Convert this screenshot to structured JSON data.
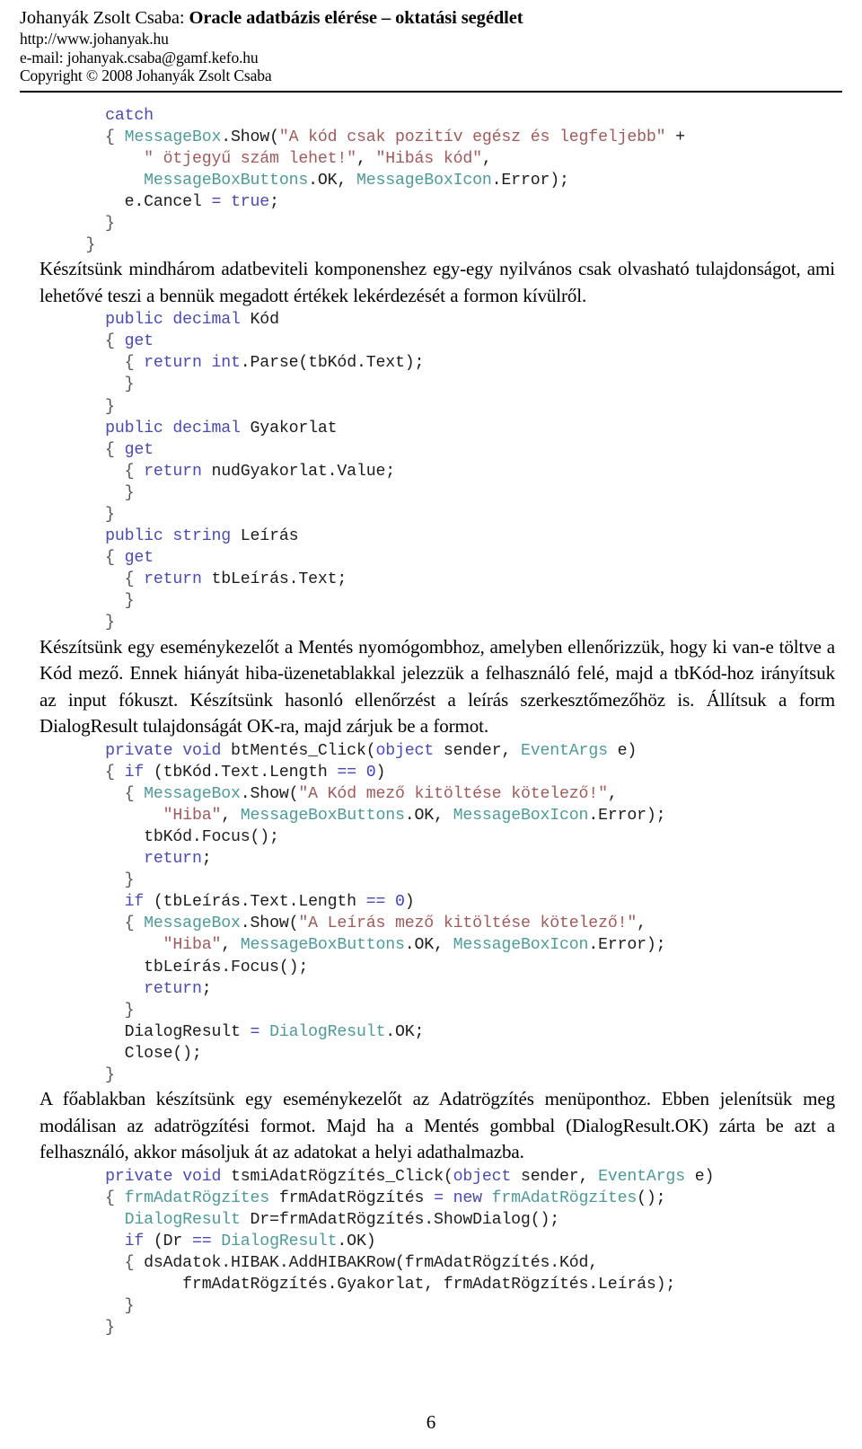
{
  "header": {
    "author_label": "Johanyák Zsolt Csaba: ",
    "title": "Oracle adatbázis elérése – oktatási segédlet",
    "website": "http://www.johanyak.hu",
    "email": "e-mail: johanyak.csaba@gamf.kefo.hu",
    "copyright": "Copyright © 2008 Johanyák Zsolt Csaba"
  },
  "blocks": [
    {
      "id": "code-catch-block",
      "type": "code",
      "lines": [
        [
          {
            "t": "    ",
            "c": "pl"
          },
          {
            "t": "catch",
            "c": "kw"
          }
        ],
        [
          {
            "t": "    { ",
            "c": "br"
          },
          {
            "t": "MessageBox",
            "c": "cls"
          },
          {
            "t": ".Show(",
            "c": "pl"
          },
          {
            "t": "\"A kód csak pozitív egész és legfeljebb\"",
            "c": "str"
          },
          {
            "t": " +",
            "c": "pl"
          }
        ],
        [
          {
            "t": "        ",
            "c": "pl"
          },
          {
            "t": "\" ötjegyű szám lehet!\"",
            "c": "str"
          },
          {
            "t": ", ",
            "c": "pl"
          },
          {
            "t": "\"Hibás kód\"",
            "c": "str"
          },
          {
            "t": ",",
            "c": "pl"
          }
        ],
        [
          {
            "t": "        ",
            "c": "pl"
          },
          {
            "t": "MessageBoxButtons",
            "c": "cls"
          },
          {
            "t": ".OK, ",
            "c": "pl"
          },
          {
            "t": "MessageBoxIcon",
            "c": "cls"
          },
          {
            "t": ".Error);",
            "c": "pl"
          }
        ],
        [
          {
            "t": "      e.Cancel ",
            "c": "pl"
          },
          {
            "t": "=",
            "c": "op"
          },
          {
            "t": " ",
            "c": "pl"
          },
          {
            "t": "true",
            "c": "kw"
          },
          {
            "t": ";",
            "c": "pl"
          }
        ],
        [
          {
            "t": "    }",
            "c": "br"
          }
        ],
        [
          {
            "t": "  }",
            "c": "br"
          }
        ]
      ]
    },
    {
      "id": "prose-readonly-properties",
      "type": "prose",
      "text": "Készítsünk mindhárom adatbeviteli komponenshez egy-egy nyilvános csak olvasható tulajdonságot, ami lehetővé teszi a bennük megadott értékek lekérdezését a formon kívülről."
    },
    {
      "id": "code-properties-block",
      "type": "code",
      "lines": [
        [
          {
            "t": "    ",
            "c": "pl"
          },
          {
            "t": "public",
            "c": "kw"
          },
          {
            "t": " ",
            "c": "pl"
          },
          {
            "t": "decimal",
            "c": "kw"
          },
          {
            "t": " Kód",
            "c": "pl"
          }
        ],
        [
          {
            "t": "    { ",
            "c": "br"
          },
          {
            "t": "get",
            "c": "kw"
          }
        ],
        [
          {
            "t": "      { ",
            "c": "br"
          },
          {
            "t": "return",
            "c": "kw"
          },
          {
            "t": " ",
            "c": "pl"
          },
          {
            "t": "int",
            "c": "kw"
          },
          {
            "t": ".Parse(tbKód.Text);",
            "c": "pl"
          }
        ],
        [
          {
            "t": "      }",
            "c": "br"
          }
        ],
        [
          {
            "t": "    }",
            "c": "br"
          }
        ],
        [
          {
            "t": "    ",
            "c": "pl"
          },
          {
            "t": "public",
            "c": "kw"
          },
          {
            "t": " ",
            "c": "pl"
          },
          {
            "t": "decimal",
            "c": "kw"
          },
          {
            "t": " Gyakorlat",
            "c": "pl"
          }
        ],
        [
          {
            "t": "    { ",
            "c": "br"
          },
          {
            "t": "get",
            "c": "kw"
          }
        ],
        [
          {
            "t": "      { ",
            "c": "br"
          },
          {
            "t": "return",
            "c": "kw"
          },
          {
            "t": " nudGyakorlat.Value;",
            "c": "pl"
          }
        ],
        [
          {
            "t": "      }",
            "c": "br"
          }
        ],
        [
          {
            "t": "    }",
            "c": "br"
          }
        ],
        [
          {
            "t": "    ",
            "c": "pl"
          },
          {
            "t": "public",
            "c": "kw"
          },
          {
            "t": " ",
            "c": "pl"
          },
          {
            "t": "string",
            "c": "kw"
          },
          {
            "t": " Leírás",
            "c": "pl"
          }
        ],
        [
          {
            "t": "    { ",
            "c": "br"
          },
          {
            "t": "get",
            "c": "kw"
          }
        ],
        [
          {
            "t": "      { ",
            "c": "br"
          },
          {
            "t": "return",
            "c": "kw"
          },
          {
            "t": " tbLeírás.Text;",
            "c": "pl"
          }
        ],
        [
          {
            "t": "      }",
            "c": "br"
          }
        ],
        [
          {
            "t": "    }",
            "c": "br"
          }
        ]
      ]
    },
    {
      "id": "prose-save-handler",
      "type": "prose",
      "text": "Készítsünk egy eseménykezelőt a Mentés nyomógombhoz, amelyben ellenőrizzük, hogy ki van-e töltve a Kód mező. Ennek hiányát hiba-üzenetablakkal jelezzük a felhasználó felé, majd a tbKód-hoz irányítsuk az input fókuszt. Készítsünk hasonló ellenőrzést a leírás szerkesztőmezőhöz is. Állítsuk a form DialogResult tulajdonságát OK-ra, majd zárjuk be a formot."
    },
    {
      "id": "code-btmentes-click",
      "type": "code",
      "lines": [
        [
          {
            "t": "    ",
            "c": "pl"
          },
          {
            "t": "private",
            "c": "kw"
          },
          {
            "t": " ",
            "c": "pl"
          },
          {
            "t": "void",
            "c": "kw"
          },
          {
            "t": " btMentés_Click(",
            "c": "pl"
          },
          {
            "t": "object",
            "c": "kw"
          },
          {
            "t": " sender, ",
            "c": "pl"
          },
          {
            "t": "EventArgs",
            "c": "cls"
          },
          {
            "t": " e)",
            "c": "pl"
          }
        ],
        [
          {
            "t": "    { ",
            "c": "br"
          },
          {
            "t": "if",
            "c": "kw"
          },
          {
            "t": " (tbKód.Text.Length ",
            "c": "pl"
          },
          {
            "t": "==",
            "c": "op"
          },
          {
            "t": " ",
            "c": "pl"
          },
          {
            "t": "0",
            "c": "num"
          },
          {
            "t": ")",
            "c": "pl"
          }
        ],
        [
          {
            "t": "      { ",
            "c": "br"
          },
          {
            "t": "MessageBox",
            "c": "cls"
          },
          {
            "t": ".Show(",
            "c": "pl"
          },
          {
            "t": "\"A Kód mező kitöltése kötelező!\"",
            "c": "str"
          },
          {
            "t": ",",
            "c": "pl"
          }
        ],
        [
          {
            "t": "          ",
            "c": "pl"
          },
          {
            "t": "\"Hiba\"",
            "c": "str"
          },
          {
            "t": ", ",
            "c": "pl"
          },
          {
            "t": "MessageBoxButtons",
            "c": "cls"
          },
          {
            "t": ".OK, ",
            "c": "pl"
          },
          {
            "t": "MessageBoxIcon",
            "c": "cls"
          },
          {
            "t": ".Error);",
            "c": "pl"
          }
        ],
        [
          {
            "t": "        tbKód.Focus();",
            "c": "pl"
          }
        ],
        [
          {
            "t": "        ",
            "c": "pl"
          },
          {
            "t": "return",
            "c": "kw"
          },
          {
            "t": ";",
            "c": "pl"
          }
        ],
        [
          {
            "t": "      }",
            "c": "br"
          }
        ],
        [
          {
            "t": "      ",
            "c": "pl"
          },
          {
            "t": "if",
            "c": "kw"
          },
          {
            "t": " (tbLeírás.Text.Length ",
            "c": "pl"
          },
          {
            "t": "==",
            "c": "op"
          },
          {
            "t": " ",
            "c": "pl"
          },
          {
            "t": "0",
            "c": "num"
          },
          {
            "t": ")",
            "c": "pl"
          }
        ],
        [
          {
            "t": "      { ",
            "c": "br"
          },
          {
            "t": "MessageBox",
            "c": "cls"
          },
          {
            "t": ".Show(",
            "c": "pl"
          },
          {
            "t": "\"A Leírás mező kitöltése kötelező!\"",
            "c": "str"
          },
          {
            "t": ",",
            "c": "pl"
          }
        ],
        [
          {
            "t": "          ",
            "c": "pl"
          },
          {
            "t": "\"Hiba\"",
            "c": "str"
          },
          {
            "t": ", ",
            "c": "pl"
          },
          {
            "t": "MessageBoxButtons",
            "c": "cls"
          },
          {
            "t": ".OK, ",
            "c": "pl"
          },
          {
            "t": "MessageBoxIcon",
            "c": "cls"
          },
          {
            "t": ".Error);",
            "c": "pl"
          }
        ],
        [
          {
            "t": "        tbLeírás.Focus();",
            "c": "pl"
          }
        ],
        [
          {
            "t": "        ",
            "c": "pl"
          },
          {
            "t": "return",
            "c": "kw"
          },
          {
            "t": ";",
            "c": "pl"
          }
        ],
        [
          {
            "t": "      }",
            "c": "br"
          }
        ],
        [
          {
            "t": "      DialogResult ",
            "c": "pl"
          },
          {
            "t": "=",
            "c": "op"
          },
          {
            "t": " ",
            "c": "pl"
          },
          {
            "t": "DialogResult",
            "c": "cls"
          },
          {
            "t": ".OK;",
            "c": "pl"
          }
        ],
        [
          {
            "t": "      Close();",
            "c": "pl"
          }
        ],
        [
          {
            "t": "    }",
            "c": "br"
          }
        ]
      ]
    },
    {
      "id": "prose-mainform-handler",
      "type": "prose",
      "text": "A főablakban készítsünk egy eseménykezelőt az Adatrögzítés menüponthoz. Ebben jelenítsük meg modálisan az adatrögzítési formot. Majd ha a Mentés gombbal (DialogResult.OK) zárta be azt a felhasználó, akkor másoljuk át az adatokat a helyi adathalmazba."
    },
    {
      "id": "code-tsmiadatrogzites-click",
      "type": "code",
      "lines": [
        [
          {
            "t": "    ",
            "c": "pl"
          },
          {
            "t": "private",
            "c": "kw"
          },
          {
            "t": " ",
            "c": "pl"
          },
          {
            "t": "void",
            "c": "kw"
          },
          {
            "t": " tsmiAdatRögzítés_Click(",
            "c": "pl"
          },
          {
            "t": "object",
            "c": "kw"
          },
          {
            "t": " sender, ",
            "c": "pl"
          },
          {
            "t": "EventArgs",
            "c": "cls"
          },
          {
            "t": " e)",
            "c": "pl"
          }
        ],
        [
          {
            "t": "    { ",
            "c": "br"
          },
          {
            "t": "frmAdatRögzítes",
            "c": "cls"
          },
          {
            "t": " frmAdatRögzítés ",
            "c": "pl"
          },
          {
            "t": "=",
            "c": "op"
          },
          {
            "t": " ",
            "c": "pl"
          },
          {
            "t": "new",
            "c": "kw"
          },
          {
            "t": " ",
            "c": "pl"
          },
          {
            "t": "frmAdatRögzítes",
            "c": "cls"
          },
          {
            "t": "();",
            "c": "pl"
          }
        ],
        [
          {
            "t": "      ",
            "c": "pl"
          },
          {
            "t": "DialogResult",
            "c": "cls"
          },
          {
            "t": " Dr=frmAdatRögzítés.ShowDialog();",
            "c": "pl"
          }
        ],
        [
          {
            "t": "      ",
            "c": "pl"
          },
          {
            "t": "if",
            "c": "kw"
          },
          {
            "t": " (Dr ",
            "c": "pl"
          },
          {
            "t": "==",
            "c": "op"
          },
          {
            "t": " ",
            "c": "pl"
          },
          {
            "t": "DialogResult",
            "c": "cls"
          },
          {
            "t": ".OK)",
            "c": "pl"
          }
        ],
        [
          {
            "t": "      { ",
            "c": "br"
          },
          {
            "t": "dsAdatok.HIBAK.AddHIBAKRow(frmAdatRögzítés.Kód,",
            "c": "pl"
          }
        ],
        [
          {
            "t": "            frmAdatRögzítés.Gyakorlat, frmAdatRögzítés.Leírás);",
            "c": "pl"
          }
        ],
        [
          {
            "t": "      }",
            "c": "br"
          }
        ],
        [
          {
            "t": "    }",
            "c": "br"
          }
        ]
      ]
    }
  ],
  "footer": {
    "page_number": "6"
  }
}
